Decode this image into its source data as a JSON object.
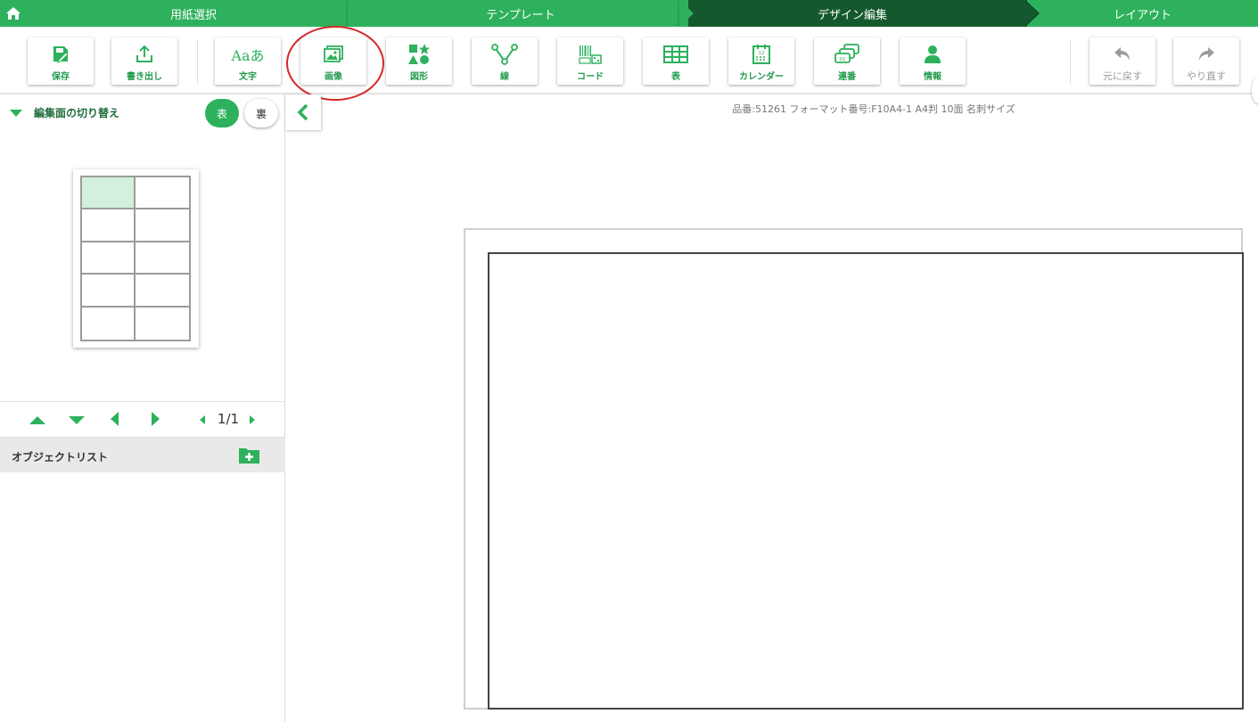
{
  "steps": [
    {
      "label": "用紙選択"
    },
    {
      "label": "テンプレート"
    },
    {
      "label": "デザイン編集"
    },
    {
      "label": "レイアウト"
    }
  ],
  "active_step_index": 2,
  "colors": {
    "brand_green": "#2db15c",
    "active_step": "#14592d",
    "highlight_circle": "#d42a2a"
  },
  "toolbar": {
    "save": "保存",
    "export": "書き出し",
    "text": "文字",
    "text_icon_glyph": "Aaあ",
    "image": "画像",
    "shape": "図形",
    "line": "線",
    "code": "コード",
    "table": "表",
    "calendar": "カレンダー",
    "numbering": "連番",
    "info": "情報",
    "undo": "元に戻す",
    "redo": "やり直す"
  },
  "left_panel": {
    "switch_title": "編集面の切り替え",
    "front_label": "表",
    "back_label": "裏",
    "page_indicator": "1/1",
    "object_list_title": "オブジェクトリスト"
  },
  "canvas": {
    "product_info": "品番:51261 フォーマット番号:F10A4-1 A4判 10面 名刺サイズ"
  }
}
